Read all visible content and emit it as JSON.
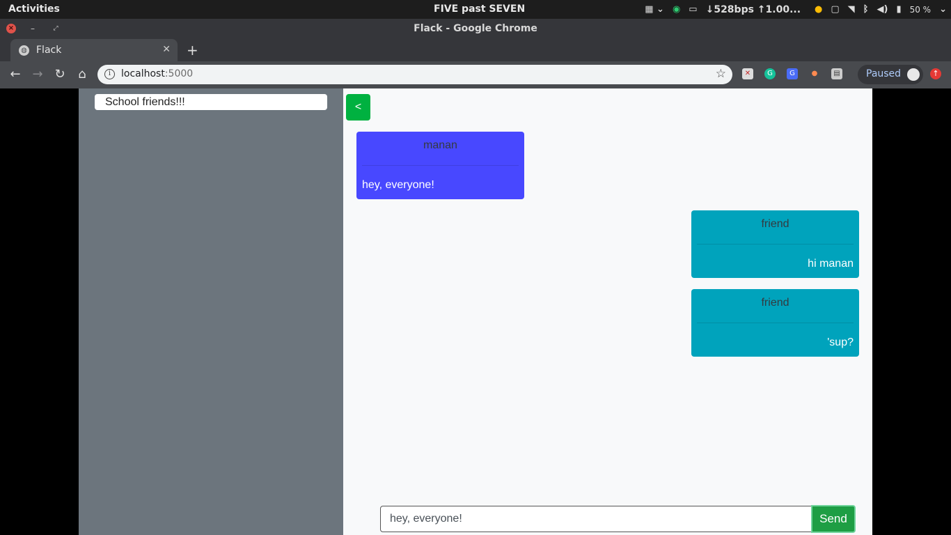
{
  "system": {
    "activities": "Activities",
    "clock": "FIVE past SEVEN",
    "network_speed": "↓528bps ↑1.00...",
    "battery": "50 %"
  },
  "window": {
    "title": "Flack - Google Chrome"
  },
  "browser": {
    "tab_label": "Flack",
    "url_host": "localhost",
    "url_port": ":5000",
    "profile_label": "Paused"
  },
  "sidebar": {
    "channels": [
      {
        "label": "School friends!!!"
      }
    ]
  },
  "chat": {
    "back_label": "<",
    "messages": [
      {
        "sender": "manan",
        "text": "hey, everyone!",
        "side": "mine"
      },
      {
        "sender": "friend",
        "text": "hi manan",
        "side": "theirs"
      },
      {
        "sender": "friend",
        "text": "'sup?",
        "side": "theirs"
      }
    ],
    "input_value": "hey, everyone!",
    "send_label": "Send"
  },
  "colors": {
    "sidebar_bg": "#6c757d",
    "own_message": "#4848ff",
    "other_message": "#00a3bc",
    "action_green": "#00b140"
  },
  "icons": {
    "tab": "globe-icon",
    "back": "arrow-left-icon",
    "forward": "arrow-right-icon",
    "reload": "reload-icon",
    "home": "home-icon",
    "bookmark": "star-icon"
  }
}
